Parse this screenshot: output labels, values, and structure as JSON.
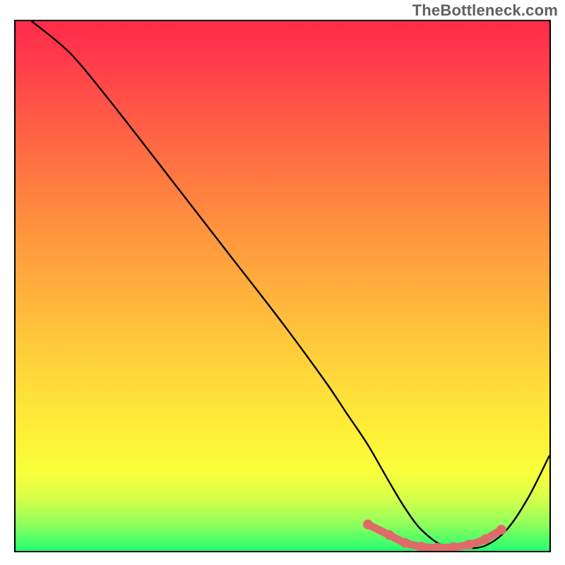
{
  "watermark": "TheBottleneck.com",
  "chart_data": {
    "type": "line",
    "title": "",
    "xlabel": "",
    "ylabel": "",
    "xlim": [
      0,
      100
    ],
    "ylim": [
      0,
      100
    ],
    "grid": false,
    "legend": false,
    "annotations": [],
    "series": [
      {
        "name": "bottleneck-curve",
        "x": [
          3,
          8,
          12,
          20,
          30,
          40,
          50,
          58,
          62,
          66,
          70,
          73,
          76,
          80,
          84,
          88,
          92,
          96,
          100
        ],
        "y": [
          100,
          96,
          92,
          82,
          69,
          56,
          43,
          32,
          26,
          20,
          13,
          8,
          4,
          1,
          0.5,
          1,
          4,
          10,
          18
        ],
        "color": "#000000"
      },
      {
        "name": "optimal-band-markers",
        "x": [
          66,
          70,
          73,
          76,
          79,
          82,
          85,
          88,
          91
        ],
        "y": [
          5,
          3,
          1.5,
          0.8,
          0.6,
          0.7,
          1.2,
          2.2,
          4
        ],
        "color": "#e06a6a"
      }
    ],
    "background_gradient": {
      "stops": [
        {
          "pos": 0,
          "color": "#ff2b4a"
        },
        {
          "pos": 8,
          "color": "#ff3d4a"
        },
        {
          "pos": 18,
          "color": "#ff5a46"
        },
        {
          "pos": 30,
          "color": "#ff7a41"
        },
        {
          "pos": 42,
          "color": "#ff9a3e"
        },
        {
          "pos": 54,
          "color": "#ffb83c"
        },
        {
          "pos": 66,
          "color": "#ffd63a"
        },
        {
          "pos": 78,
          "color": "#fff038"
        },
        {
          "pos": 85,
          "color": "#f8ff3a"
        },
        {
          "pos": 90,
          "color": "#d9ff4a"
        },
        {
          "pos": 95,
          "color": "#8fff5c"
        },
        {
          "pos": 100,
          "color": "#22ff70"
        }
      ]
    }
  }
}
